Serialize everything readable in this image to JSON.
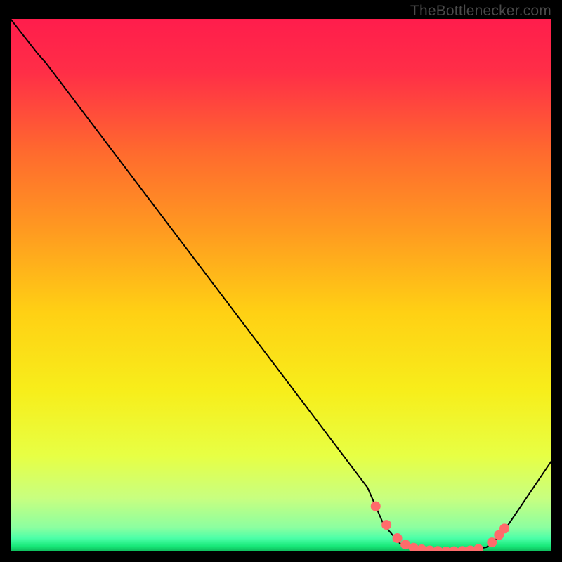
{
  "watermark": "TheBottleneсker.com",
  "chart_data": {
    "type": "line",
    "title": "",
    "xlabel": "",
    "ylabel": "",
    "xlim": [
      0,
      100
    ],
    "ylim": [
      0,
      100
    ],
    "gradient_stops": [
      {
        "offset": 0,
        "color": "#ff1d4c"
      },
      {
        "offset": 0.1,
        "color": "#ff2e47"
      },
      {
        "offset": 0.25,
        "color": "#ff6a2e"
      },
      {
        "offset": 0.4,
        "color": "#ff9b20"
      },
      {
        "offset": 0.55,
        "color": "#ffd014"
      },
      {
        "offset": 0.7,
        "color": "#f7ee1b"
      },
      {
        "offset": 0.82,
        "color": "#e7ff44"
      },
      {
        "offset": 0.9,
        "color": "#c8ff80"
      },
      {
        "offset": 0.955,
        "color": "#8cffa0"
      },
      {
        "offset": 0.975,
        "color": "#4cffa8"
      },
      {
        "offset": 0.99,
        "color": "#18e879"
      },
      {
        "offset": 1.0,
        "color": "#0db85a"
      }
    ],
    "curve": [
      {
        "x": 0,
        "y": 100
      },
      {
        "x": 5,
        "y": 93.5
      },
      {
        "x": 6.5,
        "y": 91.8
      },
      {
        "x": 66,
        "y": 12
      },
      {
        "x": 69,
        "y": 5
      },
      {
        "x": 72,
        "y": 1.5
      },
      {
        "x": 75,
        "y": 0.4
      },
      {
        "x": 80,
        "y": 0
      },
      {
        "x": 85,
        "y": 0.2
      },
      {
        "x": 88,
        "y": 0.8
      },
      {
        "x": 90,
        "y": 2.5
      },
      {
        "x": 92,
        "y": 5
      },
      {
        "x": 100,
        "y": 17
      }
    ],
    "markers": [
      {
        "x": 67.5,
        "y": 8.5
      },
      {
        "x": 69.5,
        "y": 5
      },
      {
        "x": 71.5,
        "y": 2.5
      },
      {
        "x": 73.0,
        "y": 1.3
      },
      {
        "x": 74.5,
        "y": 0.7
      },
      {
        "x": 76.0,
        "y": 0.4
      },
      {
        "x": 77.5,
        "y": 0.2
      },
      {
        "x": 79.0,
        "y": 0.1
      },
      {
        "x": 80.5,
        "y": 0
      },
      {
        "x": 82.0,
        "y": 0.05
      },
      {
        "x": 83.5,
        "y": 0.1
      },
      {
        "x": 85.0,
        "y": 0.2
      },
      {
        "x": 86.5,
        "y": 0.45
      },
      {
        "x": 89.0,
        "y": 1.7
      },
      {
        "x": 90.3,
        "y": 3.1
      },
      {
        "x": 91.3,
        "y": 4.3
      }
    ],
    "line_color": "#000000",
    "marker_color": "#ff6b6b"
  }
}
